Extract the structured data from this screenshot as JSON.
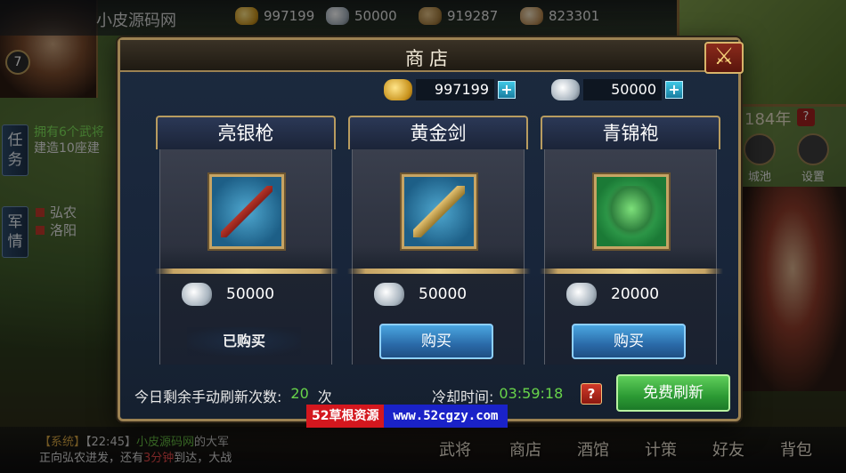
{
  "top_bar": {
    "app_name": "小皮源码网",
    "resources": [
      {
        "icon": "gold-ingot-icon",
        "value": "997199"
      },
      {
        "icon": "silver-ingot-icon",
        "value": "50000"
      },
      {
        "icon": "grain-icon",
        "value": "919287"
      },
      {
        "icon": "bag-icon",
        "value": "823301"
      }
    ]
  },
  "player": {
    "level": "7"
  },
  "left_panel": {
    "task_tab": "任务",
    "task_lines": [
      "拥有6个武将",
      "建造10座建"
    ],
    "intel_tab": "军情",
    "map_lines": [
      "弘农",
      "洛阳"
    ]
  },
  "right_panel": {
    "year": "184年",
    "help": "?",
    "icons": [
      {
        "label": "城池",
        "icon": "city-icon"
      },
      {
        "label": "设置",
        "icon": "gear-icon"
      }
    ]
  },
  "chat": {
    "line1_tag": "【系统】",
    "line1_time": "【22:45】",
    "line1_name": "小皮源码网",
    "line1_text": "的大军",
    "line2_pre": "正向弘农进发，还有",
    "line2_red": "3分钟",
    "line2_post": "到达，大战"
  },
  "bottom_nav": [
    "武将",
    "商店",
    "酒馆",
    "计策",
    "好友",
    "背包"
  ],
  "shop": {
    "title": "商店",
    "close_icon": "crossed-swords-close-icon",
    "gold": "997199",
    "silver": "50000",
    "plus": "+",
    "items": [
      {
        "name": "亮银枪",
        "price": "50000",
        "status": "已购买",
        "art": "spear"
      },
      {
        "name": "黄金剑",
        "price": "50000",
        "button": "购买",
        "art": "sword"
      },
      {
        "name": "青锦袍",
        "price": "20000",
        "button": "购买",
        "art": "robe"
      }
    ],
    "refresh_label": "今日剩余手动刷新次数:",
    "refresh_count": "20",
    "refresh_unit": "次",
    "cooldown_label": "冷却时间:",
    "cooldown_value": "03:59:18",
    "help": "?",
    "free_refresh": "免费刷新"
  },
  "watermark": {
    "left": "52草根资源",
    "right": "www.52cgzy.com"
  },
  "colors": {
    "accent_green": "#68d44a",
    "gold_border": "#9c8252",
    "buy_blue": "#2a6aa8",
    "refresh_green": "#2c9a34"
  }
}
